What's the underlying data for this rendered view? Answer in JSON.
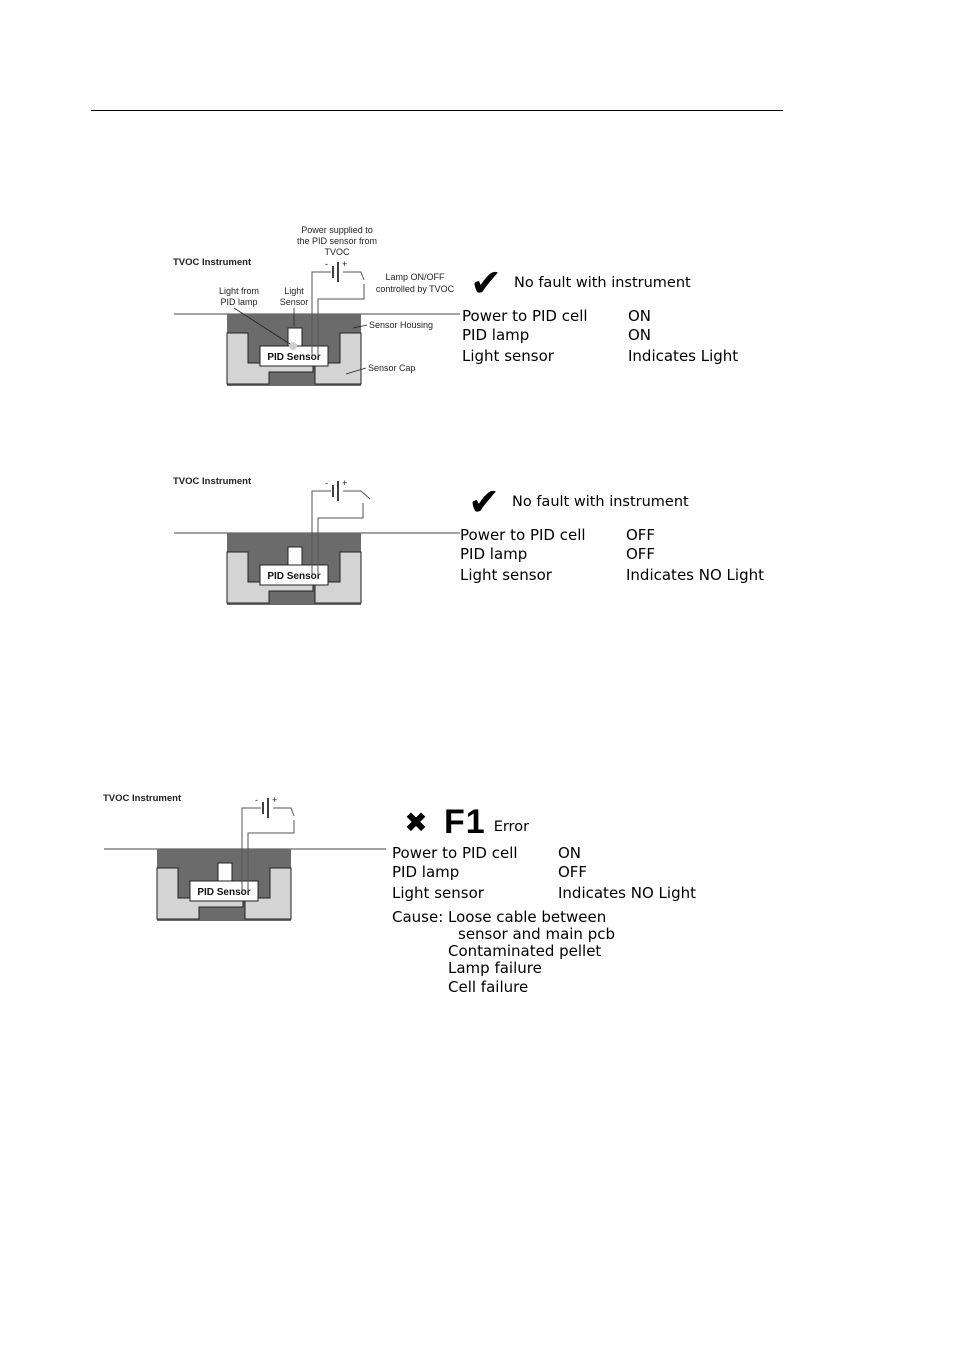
{
  "page": {
    "header_rule": true
  },
  "diagrams": [
    {
      "title": "TVOC Instrument",
      "labels": {
        "power": [
          "Power supplied to",
          "the PID sensor from",
          "TVOC"
        ],
        "lamp_switch": [
          "Lamp ON/OFF",
          "controlled by TVOC"
        ],
        "light_from": [
          "Light from",
          "PID lamp"
        ],
        "light_sensor": [
          "Light",
          "Sensor"
        ],
        "housing": "Sensor Housing",
        "cap": "Sensor Cap",
        "battery_minus": "-",
        "battery_plus": "+"
      },
      "sensor_label": "PID Sensor",
      "switch_closed": true
    },
    {
      "title": "TVOC Instrument",
      "sensor_label": "PID Sensor",
      "battery_minus": "-",
      "battery_plus": "+",
      "switch_closed": false
    },
    {
      "title": "TVOC Instrument",
      "sensor_label": "PID Sensor",
      "battery_minus": "-",
      "battery_plus": "+",
      "switch_closed": true
    }
  ],
  "states": [
    {
      "icon": "checkmark-icon",
      "icon_glyph": "✔",
      "message": "No fault with instrument",
      "rows": [
        {
          "label": "Power to PID cell",
          "value": "ON"
        },
        {
          "label": "PID lamp",
          "value": "ON"
        },
        {
          "label": "Light sensor",
          "value": "Indicates Light"
        }
      ]
    },
    {
      "icon": "checkmark-icon",
      "icon_glyph": "✔",
      "message": "No fault with instrument",
      "rows": [
        {
          "label": "Power to PID cell",
          "value": "OFF"
        },
        {
          "label": "PID lamp",
          "value": "OFF"
        },
        {
          "label": "Light sensor",
          "value": "Indicates NO Light"
        }
      ]
    },
    {
      "icon": "error-x-icon",
      "icon_glyph": "✖",
      "code": "F1",
      "message": "Error",
      "rows": [
        {
          "label": "Power to PID cell",
          "value": "ON"
        },
        {
          "label": "PID lamp",
          "value": "OFF"
        },
        {
          "label": "Light sensor",
          "value": "Indicates NO Light"
        }
      ],
      "cause_label": "Cause:",
      "causes": [
        "Loose cable between",
        "sensor and main pcb",
        "Contaminated pellet",
        "Lamp failure",
        "Cell failure"
      ]
    }
  ],
  "colors": {
    "housing": "#6b6b6b",
    "cap": "#d4d4d4",
    "sensor_body": "#ffffff",
    "wire": "#555555",
    "text": "#000000"
  }
}
